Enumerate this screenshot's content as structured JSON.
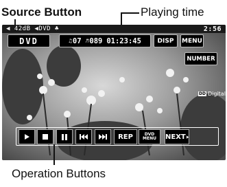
{
  "callouts": {
    "source_button": "Source Button",
    "playing_time": "Playing time",
    "operation_buttons": "Operation Buttons"
  },
  "status_bar": {
    "left_text": "◀ 42dB ◀DVD ♣",
    "clock": "2:56"
  },
  "source_button": {
    "label": "DVD"
  },
  "track_display": {
    "title": "07",
    "chapter": "089",
    "time": "01:23:45"
  },
  "top_buttons": {
    "disp": "DISP",
    "menu": "MENU",
    "number": "NUMBER"
  },
  "digital_indicator": {
    "badge": "DD",
    "label": "Digital"
  },
  "operation_buttons": {
    "play_icon": "play-icon",
    "stop_icon": "stop-icon",
    "pause_icon": "pause-icon",
    "prev_icon": "skip-back-icon",
    "next_track_icon": "skip-forward-icon",
    "rep": "REP",
    "dvd_menu_line1": "DVD",
    "dvd_menu_line2": "MENU",
    "next": "NEXT"
  },
  "colors": {
    "osd_background": "#000000",
    "osd_text": "#ffffff"
  }
}
